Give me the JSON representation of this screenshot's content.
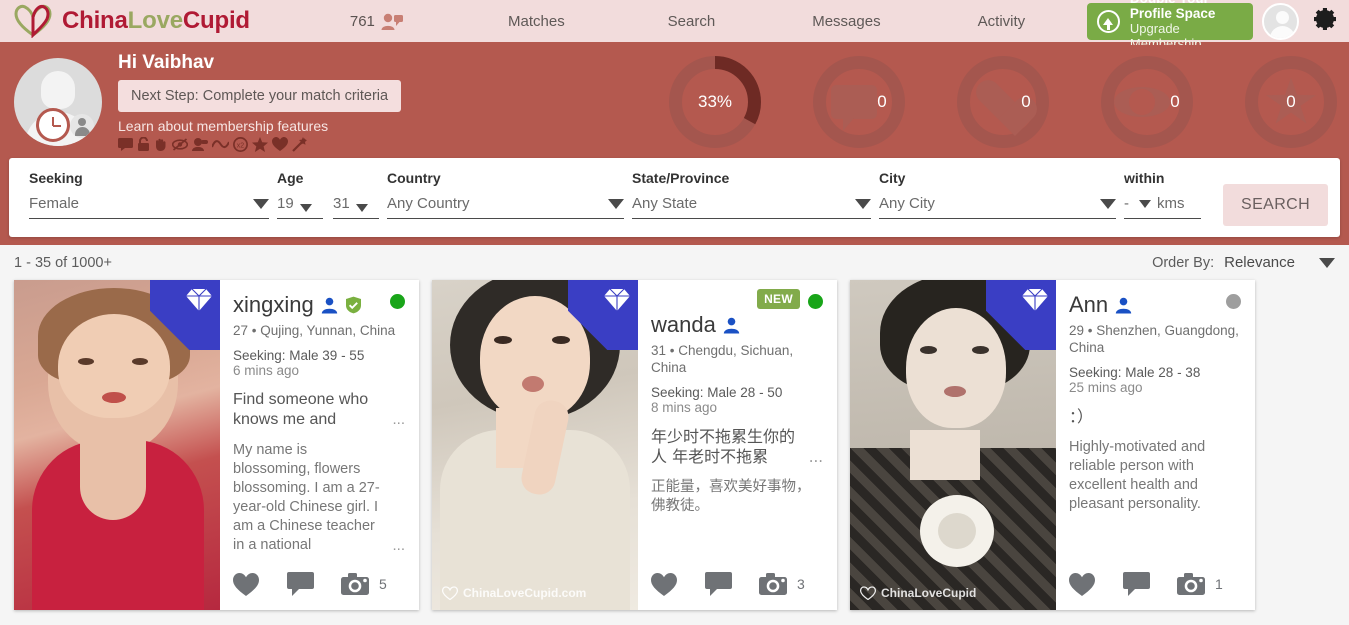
{
  "topnav": {
    "brand": {
      "part1": "China",
      "part2": "Love",
      "part3": "Cupid",
      "logo_icon": "heart-logo-icon"
    },
    "friend_count": "761",
    "friend_icon": "friends-icon",
    "links": [
      "Matches",
      "Search",
      "Messages",
      "Activity"
    ],
    "upgrade": {
      "title": "Double Your Profile Space",
      "subtitle": "Upgrade Membership",
      "icon": "up-arrow-circle-icon"
    },
    "avatar_icon": "user-avatar-icon",
    "settings_icon": "gear-icon"
  },
  "profilebar": {
    "greeting": "Hi Vaibhav",
    "next_step": "Next Step: Complete your match criteria",
    "learn_link": "Learn about membership features",
    "avatar_icon": "pending-profile-photo-icon",
    "feature_icons": [
      "chat-icon",
      "lock-icon",
      "hand-icon",
      "hidden-eye-icon",
      "anonymous-icon",
      "trend-icon",
      "x2-icon",
      "star-icon",
      "heart-icon",
      "magic-wand-icon"
    ],
    "stats": [
      {
        "name": "profile-completeness",
        "value": "33%",
        "glyph": "progress-ring",
        "percent": 33
      },
      {
        "name": "messages",
        "value": "0",
        "glyph": "chat-icon"
      },
      {
        "name": "interests",
        "value": "0",
        "glyph": "heart-icon"
      },
      {
        "name": "views",
        "value": "0",
        "glyph": "eye-icon"
      },
      {
        "name": "favourites",
        "value": "0",
        "glyph": "star-icon"
      }
    ]
  },
  "search": {
    "seeking": {
      "label": "Seeking",
      "value": "Female"
    },
    "age": {
      "label": "Age",
      "from": "19",
      "to": "31"
    },
    "country": {
      "label": "Country",
      "value": "Any Country"
    },
    "state": {
      "label": "State/Province",
      "value": "Any State"
    },
    "city": {
      "label": "City",
      "value": "Any City"
    },
    "within": {
      "label": "within",
      "value": "-",
      "unit": "kms"
    },
    "button": "SEARCH"
  },
  "results": {
    "count_text": "1 - 35 of 1000+",
    "order_label": "Order By:",
    "order_value": "Relevance"
  },
  "cards": [
    {
      "name": "xingxing",
      "meta": "27 • Qujing, Yunnan, China",
      "seeking": "Seeking: Male 39 - 55",
      "ago": "6 mins ago",
      "headline": "Find someone who knows me and",
      "blurb": "My name is blossoming, flowers blossoming. I am a 27-year-old Chinese girl. I am a Chinese teacher in a national",
      "ellipsis": "...",
      "photo_count": "5",
      "online_status": "online",
      "status_color": "#19a519",
      "verified": true,
      "new": false,
      "ribbon_icon": "diamond-badge-icon",
      "watermark": "",
      "photo_colors": [
        "#d98e82",
        "#b93c4d",
        "#e8b9a4"
      ]
    },
    {
      "name": "wanda",
      "meta": "31 • Chengdu, Sichuan, China",
      "seeking": "Seeking: Male 28 - 50",
      "ago": "8 mins ago",
      "headline": "年少时不拖累生你的人 年老时不拖累",
      "blurb": "正能量，喜欢美好事物，佛教徒。",
      "ellipsis": "...",
      "photo_count": "3",
      "online_status": "online",
      "status_color": "#19a519",
      "verified": false,
      "new": true,
      "new_label": "NEW",
      "ribbon_icon": "diamond-badge-icon",
      "watermark": "ChinaLoveCupid.com",
      "photo_colors": [
        "#cfc6bd",
        "#3a3632",
        "#e9e3da"
      ]
    },
    {
      "name": "Ann",
      "meta": "29 • Shenzhen, Guangdong, China",
      "seeking": "Seeking: Male 28 - 38",
      "ago": "25 mins ago",
      "headline": "：）",
      "blurb": "Highly-motivated and reliable person with excellent health and pleasant personality.",
      "ellipsis": "",
      "photo_count": "1",
      "online_status": "offline",
      "status_color": "#9e9e9e",
      "verified": false,
      "new": false,
      "ribbon_icon": "diamond-badge-icon",
      "watermark": "ChinaLoveCupid",
      "photo_colors": [
        "#bdb7ae",
        "#2e2b28",
        "#ded8cf"
      ]
    }
  ],
  "card_actions": {
    "like_icon": "heart-icon",
    "message_icon": "chat-icon",
    "photos_icon": "camera-icon"
  }
}
